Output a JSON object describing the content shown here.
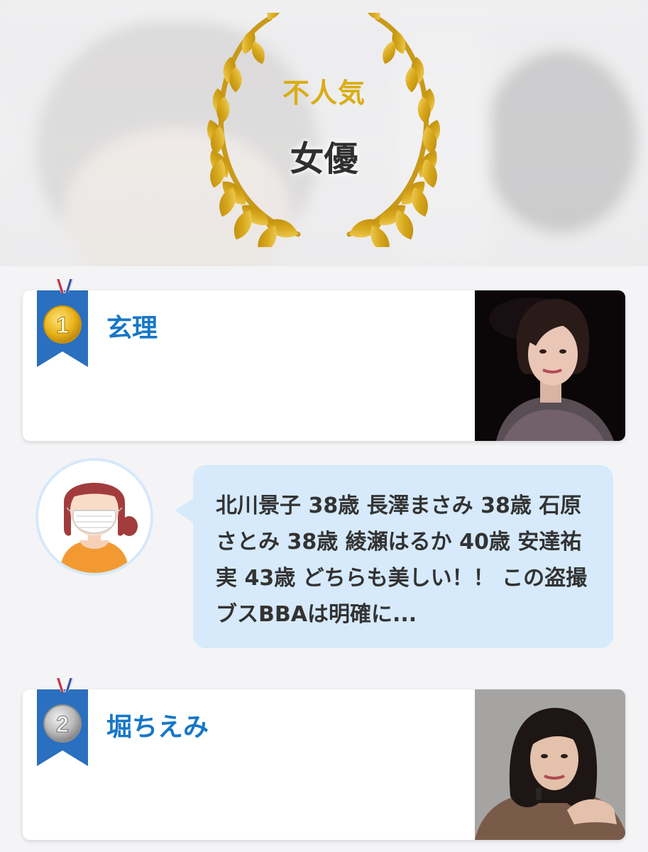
{
  "header": {
    "subtitle": "不人気",
    "title": "女優"
  },
  "ranking": [
    {
      "rank": "1",
      "name": "玄理",
      "medal": "gold-medal-icon"
    },
    {
      "rank": "2",
      "name": "堀ちえみ",
      "medal": "silver-medal-icon"
    }
  ],
  "comment": {
    "avatar": "masked-woman-avatar",
    "text": "北川景子 38歳 長澤まさみ 38歳 石原さとみ 38歳 綾瀬はるか 40歳 安達祐実 43歳 どちらも美しい！！ この盗撮ブスBBAは明確に..."
  },
  "colors": {
    "gold": "#d9ad14",
    "name_blue": "#1677c8",
    "ribbon_blue": "#2a6fc0",
    "bubble_bg": "#d6eafb"
  }
}
